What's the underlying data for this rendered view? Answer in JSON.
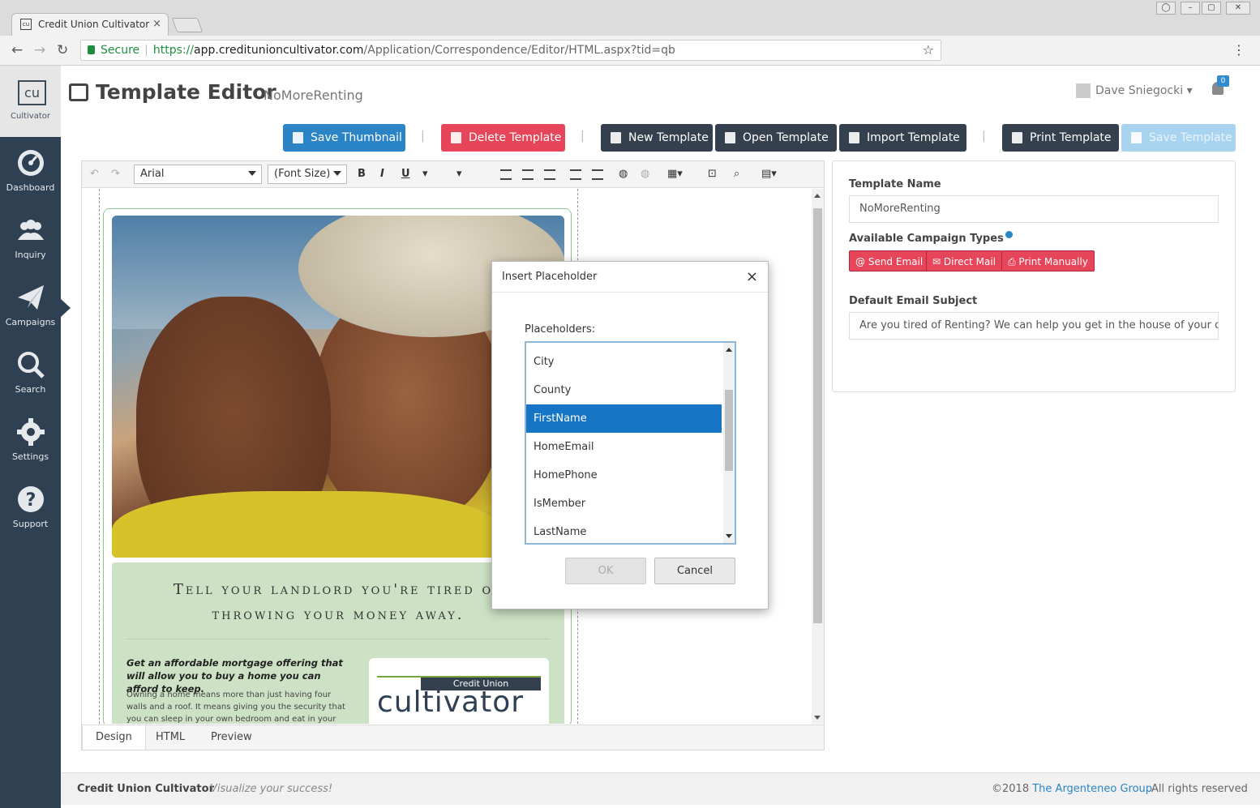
{
  "browser": {
    "tab_title": "Credit Union Cultivator",
    "favicon_text": "cu",
    "secure_label": "Secure",
    "url_scheme": "https://",
    "url_host": "app.creditunioncultivator.com",
    "url_path": "/Application/Correspondence/Editor/HTML.aspx?tid=qb"
  },
  "sidebar": {
    "brand_logo": "cu",
    "brand_label": "Cultivator",
    "items": [
      {
        "label": "Dashboard",
        "icon": "dashboard-icon"
      },
      {
        "label": "Inquiry",
        "icon": "users-icon"
      },
      {
        "label": "Campaigns",
        "icon": "paper-plane-icon",
        "active": true
      },
      {
        "label": "Search",
        "icon": "search-icon"
      },
      {
        "label": "Settings",
        "icon": "gear-icon"
      },
      {
        "label": "Support",
        "icon": "question-icon"
      }
    ]
  },
  "header": {
    "title": "Template Editor",
    "template_name": "NoMoreRenting",
    "user_name": "Dave Sniegocki",
    "notification_count": "0"
  },
  "toolbar": {
    "save_thumbnail": "Save Thumbnail",
    "delete_template": "Delete Template",
    "new_template": "New Template",
    "open_template": "Open Template",
    "import_template": "Import Template",
    "print_template": "Print Template",
    "save_template": "Save Template",
    "separator": "|"
  },
  "editor": {
    "font_name": "Arial",
    "font_size": "(Font Size)",
    "format_bold": "B",
    "format_italic": "I",
    "format_underline": "U",
    "tabs": [
      "Design",
      "HTML",
      "Preview"
    ],
    "content": {
      "headline_line1": "Tell your landlord you're tired of",
      "headline_line2": "throwing your money away.",
      "lead": "Get an affordable mortgage offering that will allow you to buy a home you can afford to keep.",
      "body": "Owning a home means more than just having four walls and a roof. It means giving you the security that you can sleep in your own bedroom and eat in your own kitchen.",
      "logo_banner": "Credit Union",
      "logo_word": "cultivator"
    }
  },
  "panel": {
    "template_name_label": "Template Name",
    "template_name_value": "NoMoreRenting",
    "campaign_types_label": "Available Campaign Types",
    "campaign_types": [
      "Send Email",
      "Direct Mail",
      "Print Manually"
    ],
    "email_subject_label": "Default Email Subject",
    "email_subject_value": "Are you tired of Renting? We can help you get in the house of your dream"
  },
  "modal": {
    "title": "Insert Placeholder",
    "close": "×",
    "placeholders_label": "Placeholders:",
    "options": [
      "City",
      "County",
      "FirstName",
      "HomeEmail",
      "HomePhone",
      "IsMember",
      "LastName"
    ],
    "selected": "FirstName",
    "ok_label": "OK",
    "cancel_label": "Cancel"
  },
  "footer": {
    "brand": "Credit Union Cultivator",
    "tagline": "Visualize your success!",
    "copyright": "©2018",
    "company": "The Argenteneo Group",
    "rights": "All rights reserved"
  },
  "colors": {
    "sidebar_bg": "#2e4052",
    "primary_blue": "#2b84c6",
    "danger_red": "#e6455a",
    "dark_button": "#34404d",
    "selected_option": "#1675c4"
  }
}
